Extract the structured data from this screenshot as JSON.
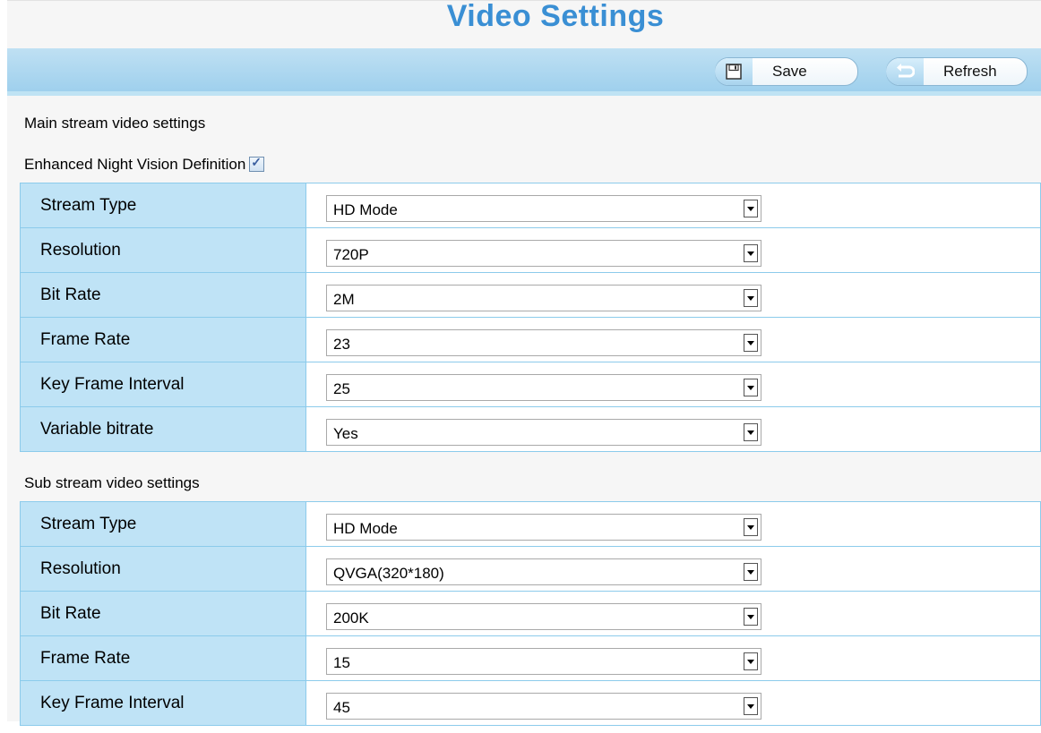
{
  "page": {
    "title": "Video Settings",
    "save_label": "Save",
    "refresh_label": "Refresh"
  },
  "main": {
    "heading": "Main stream video settings",
    "night_vision_label": "Enhanced Night Vision Definition",
    "night_vision_checked": true,
    "rows": [
      {
        "label": "Stream Type",
        "value": "HD Mode"
      },
      {
        "label": "Resolution",
        "value": "720P"
      },
      {
        "label": "Bit Rate",
        "value": "2M"
      },
      {
        "label": "Frame Rate",
        "value": "23"
      },
      {
        "label": "Key Frame Interval",
        "value": "25"
      },
      {
        "label": "Variable bitrate",
        "value": "Yes"
      }
    ]
  },
  "sub": {
    "heading": "Sub stream video settings",
    "rows": [
      {
        "label": "Stream Type",
        "value": "HD Mode"
      },
      {
        "label": "Resolution",
        "value": "QVGA(320*180)"
      },
      {
        "label": "Bit Rate",
        "value": "200K"
      },
      {
        "label": "Frame Rate",
        "value": "15"
      },
      {
        "label": "Key Frame Interval",
        "value": "45"
      }
    ]
  },
  "colors": {
    "title": "#3a8fd4",
    "toolbar": "#9fd0ed",
    "label_cell": "#bfe3f6",
    "border": "#8ccbeb"
  }
}
